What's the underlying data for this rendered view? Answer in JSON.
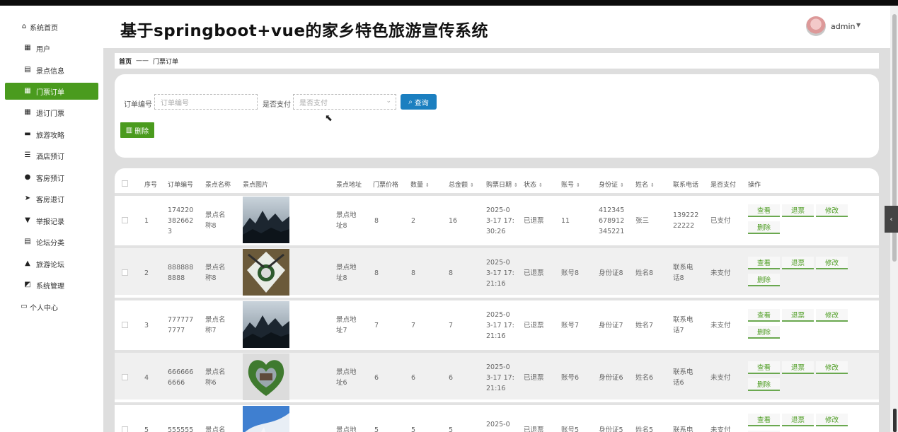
{
  "sidebar": {
    "items": [
      {
        "label": "系统首页"
      },
      {
        "label": "用户"
      },
      {
        "label": "景点信息"
      },
      {
        "label": "门票订单"
      },
      {
        "label": "退订门票"
      },
      {
        "label": "旅游攻略"
      },
      {
        "label": "酒店预订"
      },
      {
        "label": "客房预订"
      },
      {
        "label": "客房退订"
      },
      {
        "label": "举报记录"
      },
      {
        "label": "论坛分类"
      },
      {
        "label": "旅游论坛"
      },
      {
        "label": "系统管理"
      },
      {
        "label": "个人中心"
      }
    ],
    "active_index": 3
  },
  "header": {
    "title": "基于springboot+vue的家乡特色旅游宣传系统",
    "user": "admin"
  },
  "breadcrumb": {
    "home": "首页",
    "sep": "——",
    "current": "门票订单"
  },
  "search": {
    "order_label": "订单编号",
    "order_placeholder": "订单编号",
    "paid_label": "是否支付",
    "paid_placeholder": "是否支付",
    "query_button": "查询",
    "delete_button": "删除"
  },
  "table": {
    "headers": [
      "序号",
      "订单编号",
      "景点名称",
      "景点图片",
      "景点地址",
      "门票价格",
      "数量",
      "总金额",
      "购票日期",
      "状态",
      "账号",
      "身份证",
      "姓名",
      "联系电话",
      "是否支付",
      "操作"
    ],
    "actions": {
      "view": "查看",
      "refund": "退票",
      "edit": "修改",
      "delete": "删除"
    },
    "rows": [
      {
        "no": "1",
        "order": "1742203826623",
        "order_lines": [
          "174220",
          "382662",
          "3"
        ],
        "name_lines": [
          "景点名",
          "称8"
        ],
        "addr_lines": [
          "景点地",
          "址8"
        ],
        "price": "8",
        "qty": "2",
        "total": "16",
        "date_lines": [
          "2025-0",
          "3-17 17:",
          "30:26"
        ],
        "status": "已退票",
        "account": "11",
        "id_lines": [
          "412345",
          "678912",
          "345221"
        ],
        "person": "张三",
        "phone_lines": [
          "139222",
          "22222"
        ],
        "paid": "已支付"
      },
      {
        "no": "2",
        "order_lines": [
          "888888",
          "8888"
        ],
        "name_lines": [
          "景点名",
          "称8"
        ],
        "addr_lines": [
          "景点地",
          "址8"
        ],
        "price": "8",
        "qty": "8",
        "total": "8",
        "date_lines": [
          "2025-0",
          "3-17 17:",
          "21:16"
        ],
        "status": "已退票",
        "account": "账号8",
        "id_lines": [
          "身份证8"
        ],
        "person": "姓名8",
        "phone_lines": [
          "联系电",
          "话8"
        ],
        "paid": "未支付"
      },
      {
        "no": "3",
        "order_lines": [
          "777777",
          "7777"
        ],
        "name_lines": [
          "景点名",
          "称7"
        ],
        "addr_lines": [
          "景点地",
          "址7"
        ],
        "price": "7",
        "qty": "7",
        "total": "7",
        "date_lines": [
          "2025-0",
          "3-17 17:",
          "21:16"
        ],
        "status": "已退票",
        "account": "账号7",
        "id_lines": [
          "身份证7"
        ],
        "person": "姓名7",
        "phone_lines": [
          "联系电",
          "话7"
        ],
        "paid": "未支付"
      },
      {
        "no": "4",
        "order_lines": [
          "666666",
          "6666"
        ],
        "name_lines": [
          "景点名",
          "称6"
        ],
        "addr_lines": [
          "景点地",
          "址6"
        ],
        "price": "6",
        "qty": "6",
        "total": "6",
        "date_lines": [
          "2025-0",
          "3-17 17:",
          "21:16"
        ],
        "status": "已退票",
        "account": "账号6",
        "id_lines": [
          "身份证6"
        ],
        "person": "姓名6",
        "phone_lines": [
          "联系电",
          "话6"
        ],
        "paid": "未支付"
      },
      {
        "no": "5",
        "order_lines": [
          "555555"
        ],
        "name_lines": [
          "景点名"
        ],
        "addr_lines": [
          "景点地"
        ],
        "price": "5",
        "qty": "5",
        "total": "5",
        "date_lines": [
          "2025-0",
          "3-17 17:"
        ],
        "status": "已退票",
        "account": "账号5",
        "id_lines": [
          "身份证5"
        ],
        "person": "姓名5",
        "phone_lines": [
          "联系电"
        ],
        "paid": "未支付"
      }
    ]
  }
}
